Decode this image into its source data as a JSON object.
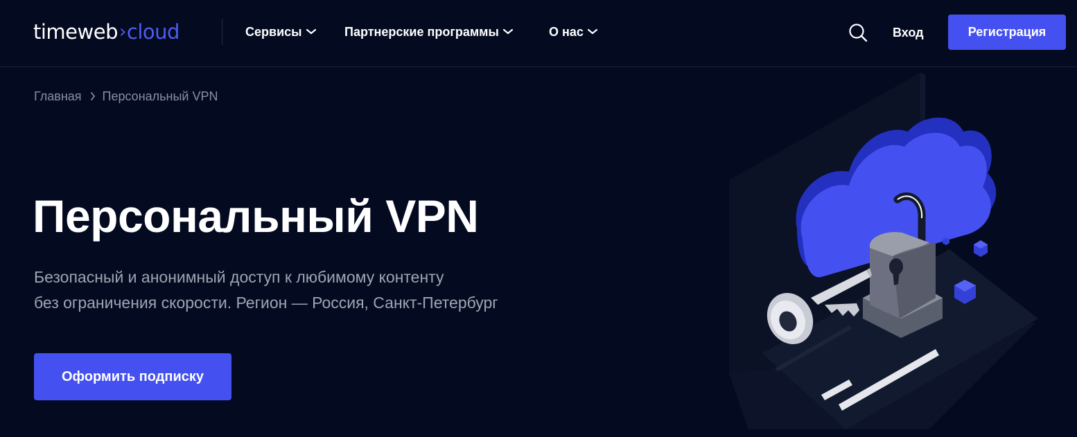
{
  "header": {
    "logo": {
      "part1": "timeweb",
      "part2": "cloud"
    },
    "nav": [
      {
        "label": "Сервисы"
      },
      {
        "label": "Партнерские программы"
      },
      {
        "label": "О нас"
      }
    ],
    "login_label": "Вход",
    "register_label": "Регистрация"
  },
  "breadcrumb": {
    "home": "Главная",
    "current": "Персональный VPN"
  },
  "hero": {
    "title": "Персональный VPN",
    "subtitle_line1": "Безопасный и анонимный доступ к любимому контенту",
    "subtitle_line2": "без ограничения скорости. Регион — Россия, Санкт-Петербург",
    "cta_label": "Оформить подписку"
  },
  "colors": {
    "background": "#040b21",
    "accent": "#4451f0",
    "muted_text": "#a0a4b2",
    "breadcrumb_text": "#8b90a0"
  },
  "icons": [
    "search-icon",
    "chevron-down-icon",
    "chevron-right-icon",
    "cloud-lock-key-illustration"
  ]
}
